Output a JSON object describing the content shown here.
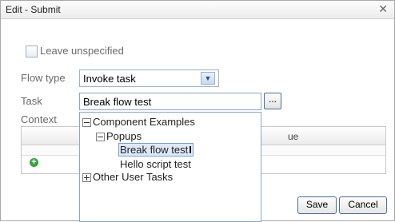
{
  "dialog": {
    "title": "Edit - Submit",
    "close_icon": "close-icon"
  },
  "form": {
    "leave_unspecified": {
      "label": "Leave unspecified",
      "checked": false
    },
    "flow_type": {
      "label": "Flow type",
      "value": "Invoke task"
    },
    "task": {
      "label": "Task",
      "value": "Break flow test",
      "browse_label": "..."
    },
    "context": {
      "label": "Context",
      "value_column_partial": "ue"
    }
  },
  "task_tree": [
    {
      "label": "Component Examples",
      "expanded": true
    },
    {
      "label": "Popups",
      "expanded": true
    },
    {
      "label": "Break flow test",
      "selected": true
    },
    {
      "label": "Hello script test"
    },
    {
      "label": "Other User Tasks",
      "expanded": false
    }
  ],
  "buttons": {
    "save": "Save",
    "cancel": "Cancel"
  },
  "colors": {
    "accent_border": "#8aa8c8",
    "selected_bg": "#dde9f8",
    "add_icon": "#3aa13a"
  }
}
